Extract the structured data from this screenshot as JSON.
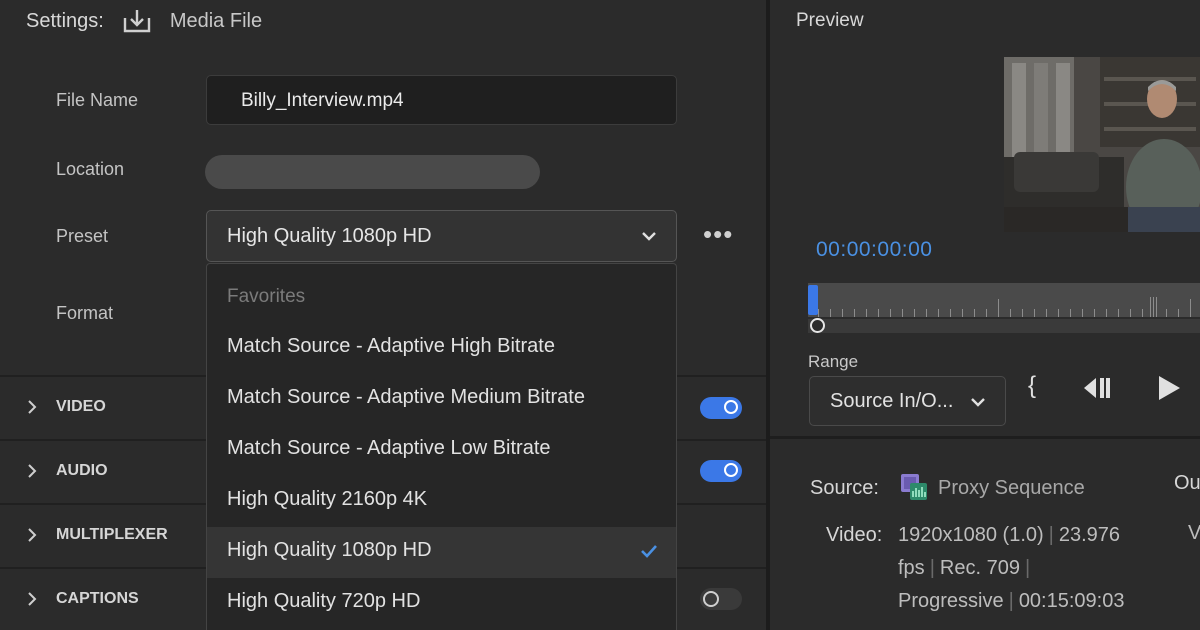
{
  "settings": {
    "title": "Settings:",
    "tab": "Media File",
    "file_name_label": "File Name",
    "file_name_value": "Billy_Interview.mp4",
    "location_label": "Location",
    "preset_label": "Preset",
    "preset_value": "High Quality 1080p HD",
    "format_label": "Format"
  },
  "sections": [
    {
      "label": "VIDEO",
      "toggle": "on"
    },
    {
      "label": "AUDIO",
      "toggle": "on"
    },
    {
      "label": "MULTIPLEXER",
      "toggle": "none"
    },
    {
      "label": "CAPTIONS",
      "toggle": "off"
    }
  ],
  "dropdown": {
    "header": "Favorites",
    "items": [
      "Match Source - Adaptive High Bitrate",
      "Match Source - Adaptive Medium Bitrate",
      "Match Source - Adaptive Low Bitrate",
      "High Quality 2160p 4K",
      "High Quality 1080p HD",
      "High Quality 720p HD"
    ],
    "selected": "High Quality 1080p HD"
  },
  "preview": {
    "title": "Preview",
    "timecode": "00:00:00:00",
    "range_label": "Range",
    "range_value": "Source In/O...",
    "source_label": "Source:",
    "source_name": "Proxy Sequence",
    "output_partial": "Ou",
    "v_partial": "V",
    "video_label": "Video:",
    "video_line1": [
      "1920x1080 (1.0)",
      "23.976"
    ],
    "video_line2": [
      "fps",
      "Rec. 709"
    ],
    "video_line3": [
      "Progressive",
      "00:15:09:03"
    ]
  },
  "colors": {
    "accent": "#3b78e7",
    "timecode": "#4a90e2",
    "panel": "#2b2b2b"
  },
  "icons": {
    "download": "download-icon",
    "more": "more-icon",
    "chevron": "chevron-down-icon",
    "check": "check-icon",
    "sequence": "sequence-icon",
    "play": "play-icon",
    "step_back": "step-back-icon"
  }
}
